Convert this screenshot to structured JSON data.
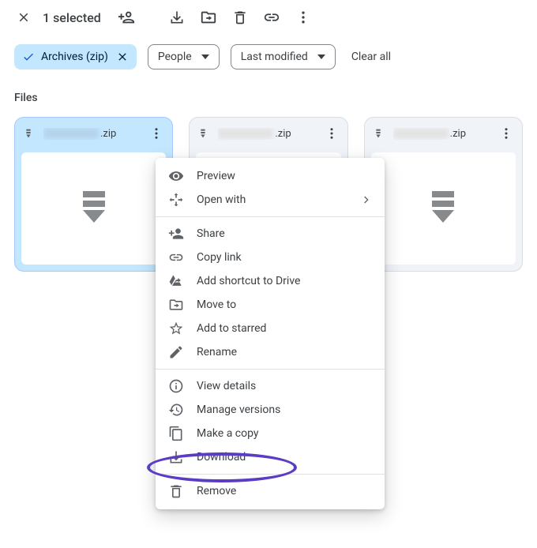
{
  "toolbar": {
    "selected_text": "1 selected"
  },
  "filters": {
    "active_chip": "Archives (zip)",
    "people": "People",
    "last_modified": "Last modified",
    "clear_all": "Clear all"
  },
  "section": {
    "files": "Files"
  },
  "cards": [
    {
      "ext": ".zip"
    },
    {
      "ext": ".zip"
    },
    {
      "ext": ".zip"
    }
  ],
  "menu": {
    "preview": "Preview",
    "open_with": "Open with",
    "share": "Share",
    "copy_link": "Copy link",
    "add_shortcut": "Add shortcut to Drive",
    "move_to": "Move to",
    "add_starred": "Add to starred",
    "rename": "Rename",
    "view_details": "View details",
    "manage_versions": "Manage versions",
    "make_copy": "Make a copy",
    "download": "Download",
    "remove": "Remove"
  }
}
